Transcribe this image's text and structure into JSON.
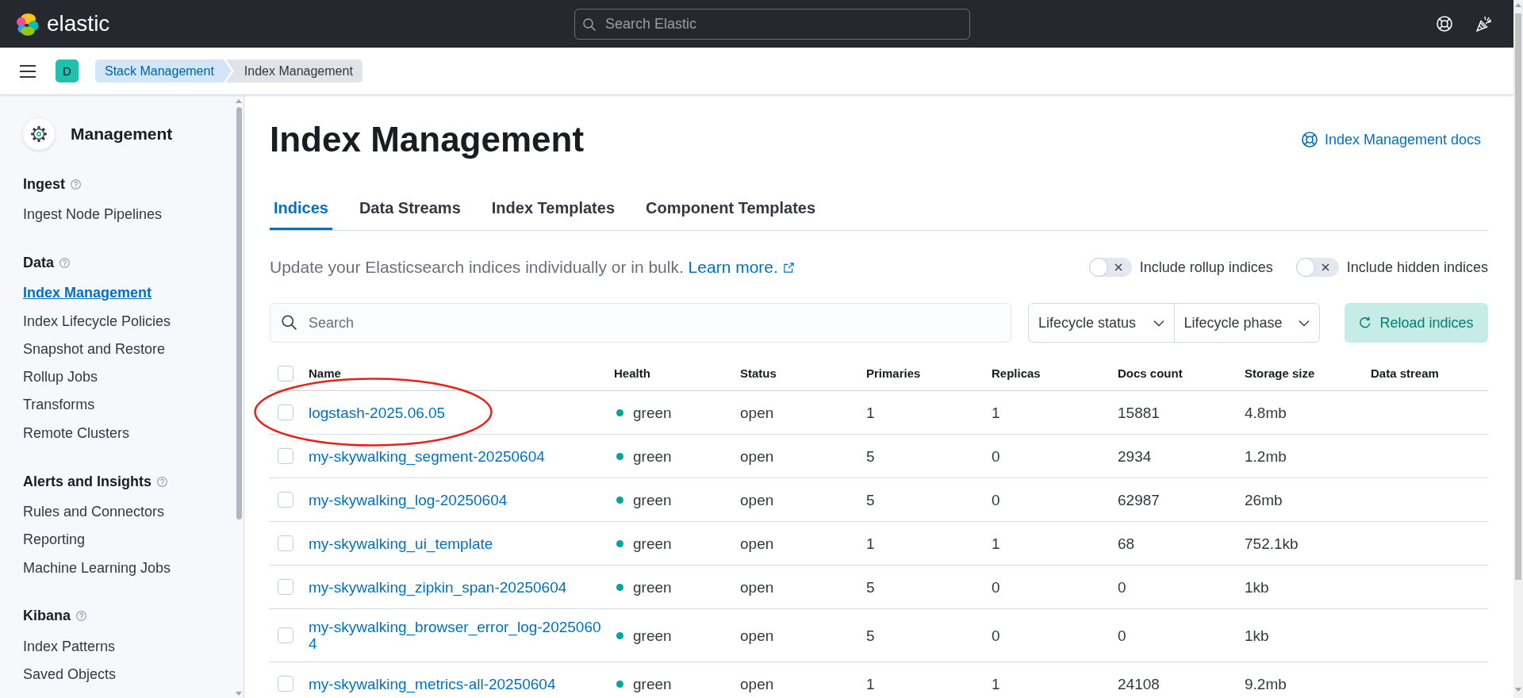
{
  "header": {
    "logo_text": "elastic",
    "search": {
      "placeholder": "Search Elastic"
    }
  },
  "nav_bar": {
    "avatar": "D",
    "breadcrumbs": [
      {
        "label": "Stack Management",
        "selected": false
      },
      {
        "label": "Index Management",
        "selected": true
      }
    ]
  },
  "sidebar": {
    "title": "Management",
    "sections": [
      {
        "title": "Ingest",
        "items": [
          {
            "label": "Ingest Node Pipelines",
            "selected": false
          }
        ]
      },
      {
        "title": "Data",
        "items": [
          {
            "label": "Index Management",
            "selected": true
          },
          {
            "label": "Index Lifecycle Policies",
            "selected": false
          },
          {
            "label": "Snapshot and Restore",
            "selected": false
          },
          {
            "label": "Rollup Jobs",
            "selected": false
          },
          {
            "label": "Transforms",
            "selected": false
          },
          {
            "label": "Remote Clusters",
            "selected": false
          }
        ]
      },
      {
        "title": "Alerts and Insights",
        "items": [
          {
            "label": "Rules and Connectors",
            "selected": false
          },
          {
            "label": "Reporting",
            "selected": false
          },
          {
            "label": "Machine Learning Jobs",
            "selected": false
          }
        ]
      },
      {
        "title": "Kibana",
        "items": [
          {
            "label": "Index Patterns",
            "selected": false
          },
          {
            "label": "Saved Objects",
            "selected": false
          }
        ]
      }
    ]
  },
  "page": {
    "title": "Index Management",
    "docs_link": "Index Management docs",
    "tabs": [
      {
        "label": "Indices",
        "selected": true
      },
      {
        "label": "Data Streams",
        "selected": false
      },
      {
        "label": "Index Templates",
        "selected": false
      },
      {
        "label": "Component Templates",
        "selected": false
      }
    ],
    "description": "Update your Elasticsearch indices individually or in bulk.",
    "learn_more": "Learn more.",
    "toggles": [
      {
        "label": "Include rollup indices",
        "on": false
      },
      {
        "label": "Include hidden indices",
        "on": false
      }
    ],
    "search": {
      "placeholder": "Search"
    },
    "filters": [
      "Lifecycle status",
      "Lifecycle phase"
    ],
    "reload_button": "Reload indices"
  },
  "table": {
    "select_all_checked": false,
    "columns": [
      "Name",
      "Health",
      "Status",
      "Primaries",
      "Replicas",
      "Docs count",
      "Storage size",
      "Data stream"
    ],
    "rows": [
      {
        "checked": false,
        "circled": true,
        "name": "logstash-2025.06.05",
        "health": "green",
        "color": "#00a69b",
        "status": "open",
        "primaries": "1",
        "replicas": "1",
        "docs_count": "15881",
        "storage_size": "4.8mb"
      },
      {
        "checked": false,
        "circled": false,
        "name": "my-skywalking_segment-20250604",
        "health": "green",
        "color": "#00a69b",
        "status": "open",
        "primaries": "5",
        "replicas": "0",
        "docs_count": "2934",
        "storage_size": "1.2mb"
      },
      {
        "checked": false,
        "circled": false,
        "name": "my-skywalking_log-20250604",
        "health": "green",
        "color": "#00a69b",
        "status": "open",
        "primaries": "5",
        "replicas": "0",
        "docs_count": "62987",
        "storage_size": "26mb"
      },
      {
        "checked": false,
        "circled": false,
        "name": "my-skywalking_ui_template",
        "health": "green",
        "color": "#00a69b",
        "status": "open",
        "primaries": "1",
        "replicas": "1",
        "docs_count": "68",
        "storage_size": "752.1kb"
      },
      {
        "checked": false,
        "circled": false,
        "name": "my-skywalking_zipkin_span-20250604",
        "health": "green",
        "color": "#00a69b",
        "status": "open",
        "primaries": "5",
        "replicas": "0",
        "docs_count": "0",
        "storage_size": "1kb"
      },
      {
        "checked": false,
        "circled": false,
        "name": "my-skywalking_browser_error_log-20250604",
        "health": "green",
        "color": "#00a69b",
        "status": "open",
        "primaries": "5",
        "replicas": "0",
        "docs_count": "0",
        "storage_size": "1kb"
      },
      {
        "checked": false,
        "circled": false,
        "name": "my-skywalking_metrics-all-20250604",
        "health": "green",
        "color": "#00a69b",
        "status": "open",
        "primaries": "1",
        "replicas": "1",
        "docs_count": "24108",
        "storage_size": "9.2mb"
      }
    ]
  }
}
